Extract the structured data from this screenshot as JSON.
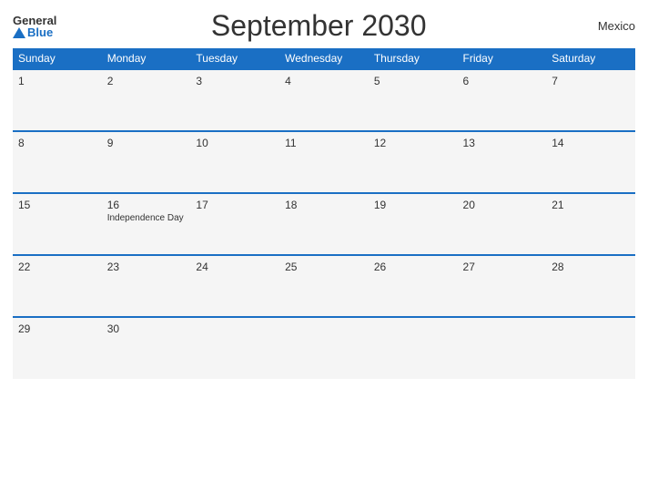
{
  "logo": {
    "general": "General",
    "blue": "Blue"
  },
  "title": "September 2030",
  "country": "Mexico",
  "days_header": [
    "Sunday",
    "Monday",
    "Tuesday",
    "Wednesday",
    "Thursday",
    "Friday",
    "Saturday"
  ],
  "weeks": [
    [
      {
        "num": "1",
        "event": ""
      },
      {
        "num": "2",
        "event": ""
      },
      {
        "num": "3",
        "event": ""
      },
      {
        "num": "4",
        "event": ""
      },
      {
        "num": "5",
        "event": ""
      },
      {
        "num": "6",
        "event": ""
      },
      {
        "num": "7",
        "event": ""
      }
    ],
    [
      {
        "num": "8",
        "event": ""
      },
      {
        "num": "9",
        "event": ""
      },
      {
        "num": "10",
        "event": ""
      },
      {
        "num": "11",
        "event": ""
      },
      {
        "num": "12",
        "event": ""
      },
      {
        "num": "13",
        "event": ""
      },
      {
        "num": "14",
        "event": ""
      }
    ],
    [
      {
        "num": "15",
        "event": ""
      },
      {
        "num": "16",
        "event": "Independence Day"
      },
      {
        "num": "17",
        "event": ""
      },
      {
        "num": "18",
        "event": ""
      },
      {
        "num": "19",
        "event": ""
      },
      {
        "num": "20",
        "event": ""
      },
      {
        "num": "21",
        "event": ""
      }
    ],
    [
      {
        "num": "22",
        "event": ""
      },
      {
        "num": "23",
        "event": ""
      },
      {
        "num": "24",
        "event": ""
      },
      {
        "num": "25",
        "event": ""
      },
      {
        "num": "26",
        "event": ""
      },
      {
        "num": "27",
        "event": ""
      },
      {
        "num": "28",
        "event": ""
      }
    ],
    [
      {
        "num": "29",
        "event": ""
      },
      {
        "num": "30",
        "event": ""
      },
      {
        "num": "",
        "event": ""
      },
      {
        "num": "",
        "event": ""
      },
      {
        "num": "",
        "event": ""
      },
      {
        "num": "",
        "event": ""
      },
      {
        "num": "",
        "event": ""
      }
    ]
  ]
}
